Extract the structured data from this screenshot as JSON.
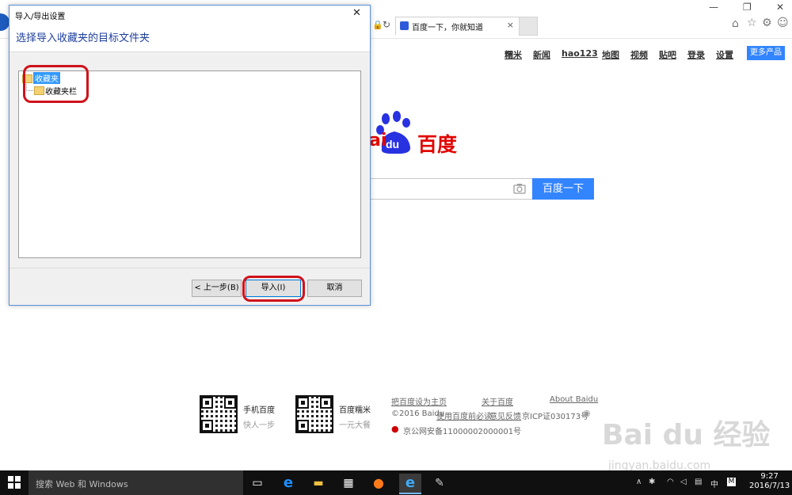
{
  "browser": {
    "tab_title": "百度一下，你就知道",
    "tab_close": "×"
  },
  "baidu": {
    "nav": [
      "糯米",
      "新闻",
      "hao123",
      "地图",
      "视频",
      "贴吧",
      "登录",
      "设置"
    ],
    "more_products": "更多产品",
    "logo_text": "ai  du 百度",
    "search_button": "百度一下",
    "footer": {
      "qr1_title": "手机百度",
      "qr1_sub": "快人一步",
      "qr2_title": "百度糯米",
      "qr2_sub": "一元大餐",
      "link_home": "把百度设为主页",
      "link_about": "关于百度",
      "link_about_en": "About  Baidu",
      "copyright": "©2016 Baidu",
      "link_must_read": "使用百度前必读",
      "link_feedback": "意见反馈",
      "icp": "京ICP证030173号",
      "police": "京公网安备11000002000001号"
    }
  },
  "dialog": {
    "title": "导入/导出设置",
    "close": "✕",
    "heading": "选择导入收藏夹的目标文件夹",
    "tree_root": "收藏夹",
    "tree_child": "收藏夹栏",
    "btn_back": "< 上一步(B)",
    "btn_import": "导入(I)",
    "btn_cancel": "取消"
  },
  "taskbar": {
    "search_placeholder": "搜索 Web 和 Windows",
    "time": "9:27",
    "date": "2016/7/13",
    "ime": "中",
    "ime2": "M"
  },
  "watermark": {
    "brand": "Bai du 经验",
    "url": "jingyan.baidu.com"
  },
  "colors": {
    "accent": "#3385ff",
    "highlight": "#d0111a",
    "logo_red": "#e10601",
    "logo_blue": "#2932e1"
  }
}
